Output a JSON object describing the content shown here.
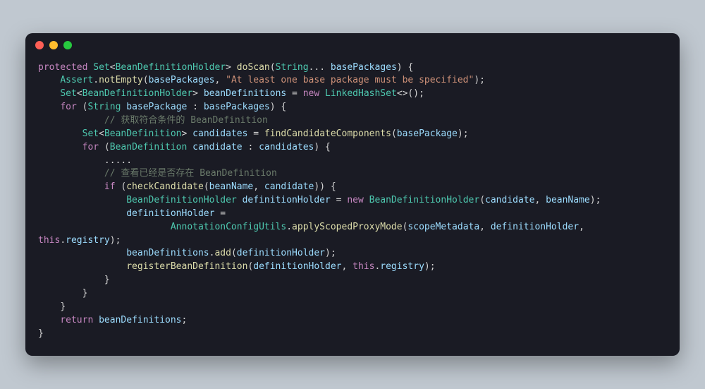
{
  "traffic": {
    "red": "#ff5f56",
    "yellow": "#ffbd2e",
    "green": "#27c93f"
  },
  "code": {
    "l1": {
      "kw1": "protected ",
      "t1": "Set",
      "p1": "<",
      "t2": "BeanDefinitionHolder",
      "p2": "> ",
      "fn": "doScan",
      "p3": "(",
      "t3": "String",
      "p4": "... ",
      "id": "basePackages",
      "p5": ") {"
    },
    "l2": {
      "indent": "    ",
      "t1": "Assert",
      "p1": ".",
      "fn": "notEmpty",
      "p2": "(",
      "id": "basePackages",
      "p3": ", ",
      "str": "\"At least one base package must be specified\"",
      "p4": ");"
    },
    "l3": {
      "indent": "    ",
      "t1": "Set",
      "p1": "<",
      "t2": "BeanDefinitionHolder",
      "p2": "> ",
      "id": "beanDefinitions",
      "op": " = ",
      "kw": "new ",
      "t3": "LinkedHashSet",
      "p3": "<>();"
    },
    "l4": {
      "indent": "    ",
      "kw": "for ",
      "p1": "(",
      "t1": "String ",
      "id": "basePackage",
      "p2": " : ",
      "id2": "basePackages",
      "p3": ") {"
    },
    "l5": {
      "indent": "            ",
      "cmt": "// 获取符合条件的 BeanDefinition"
    },
    "l6": {
      "indent": "        ",
      "t1": "Set",
      "p1": "<",
      "t2": "BeanDefinition",
      "p2": "> ",
      "id": "candidates",
      "op": " = ",
      "fn": "findCandidateComponents",
      "p3": "(",
      "id2": "basePackage",
      "p4": ");"
    },
    "l7": {
      "indent": "        ",
      "kw": "for ",
      "p1": "(",
      "t1": "BeanDefinition ",
      "id": "candidate",
      "p2": " : ",
      "id2": "candidates",
      "p3": ") {"
    },
    "l8": {
      "indent": "            ",
      "dots": "....."
    },
    "l9": {
      "indent": "            ",
      "cmt": "// 查看已经是否存在 BeanDefinition"
    },
    "l10": {
      "indent": "            ",
      "kw": "if ",
      "p1": "(",
      "fn": "checkCandidate",
      "p2": "(",
      "id1": "beanName",
      "p3": ", ",
      "id2": "candidate",
      "p4": ")) {"
    },
    "l11": {
      "indent": "                ",
      "t1": "BeanDefinitionHolder ",
      "id": "definitionHolder",
      "op": " = ",
      "kw": "new ",
      "t2": "BeanDefinitionHolder",
      "p1": "(",
      "id2": "candidate",
      "p2": ", ",
      "id3": "beanName",
      "p3": ");"
    },
    "l12": {
      "indent": "                ",
      "id": "definitionHolder",
      "op": " ="
    },
    "l13": {
      "indent": "                        ",
      "t1": "AnnotationConfigUtils",
      "p1": ".",
      "fn": "applyScopedProxyMode",
      "p2": "(",
      "id1": "scopeMetadata",
      "p3": ", ",
      "id2": "definitionHolder",
      "p4": ", "
    },
    "l14": {
      "pre": "",
      "kw": "this",
      "p1": ".",
      "id": "registry",
      "p2": ");"
    },
    "l15": {
      "indent": "                ",
      "id": "beanDefinitions",
      "p1": ".",
      "fn": "add",
      "p2": "(",
      "id2": "definitionHolder",
      "p3": ");"
    },
    "l16": {
      "indent": "                ",
      "fn": "registerBeanDefinition",
      "p1": "(",
      "id1": "definitionHolder",
      "p2": ", ",
      "kw": "this",
      "p3": ".",
      "id2": "registry",
      "p4": ");"
    },
    "l17": {
      "indent": "            ",
      "brace": "}"
    },
    "l18": {
      "indent": "        ",
      "brace": "}"
    },
    "l19": {
      "indent": "    ",
      "brace": "}"
    },
    "l20": {
      "indent": "    ",
      "kw": "return ",
      "id": "beanDefinitions",
      "p": ";"
    },
    "l21": {
      "brace": "}"
    }
  }
}
